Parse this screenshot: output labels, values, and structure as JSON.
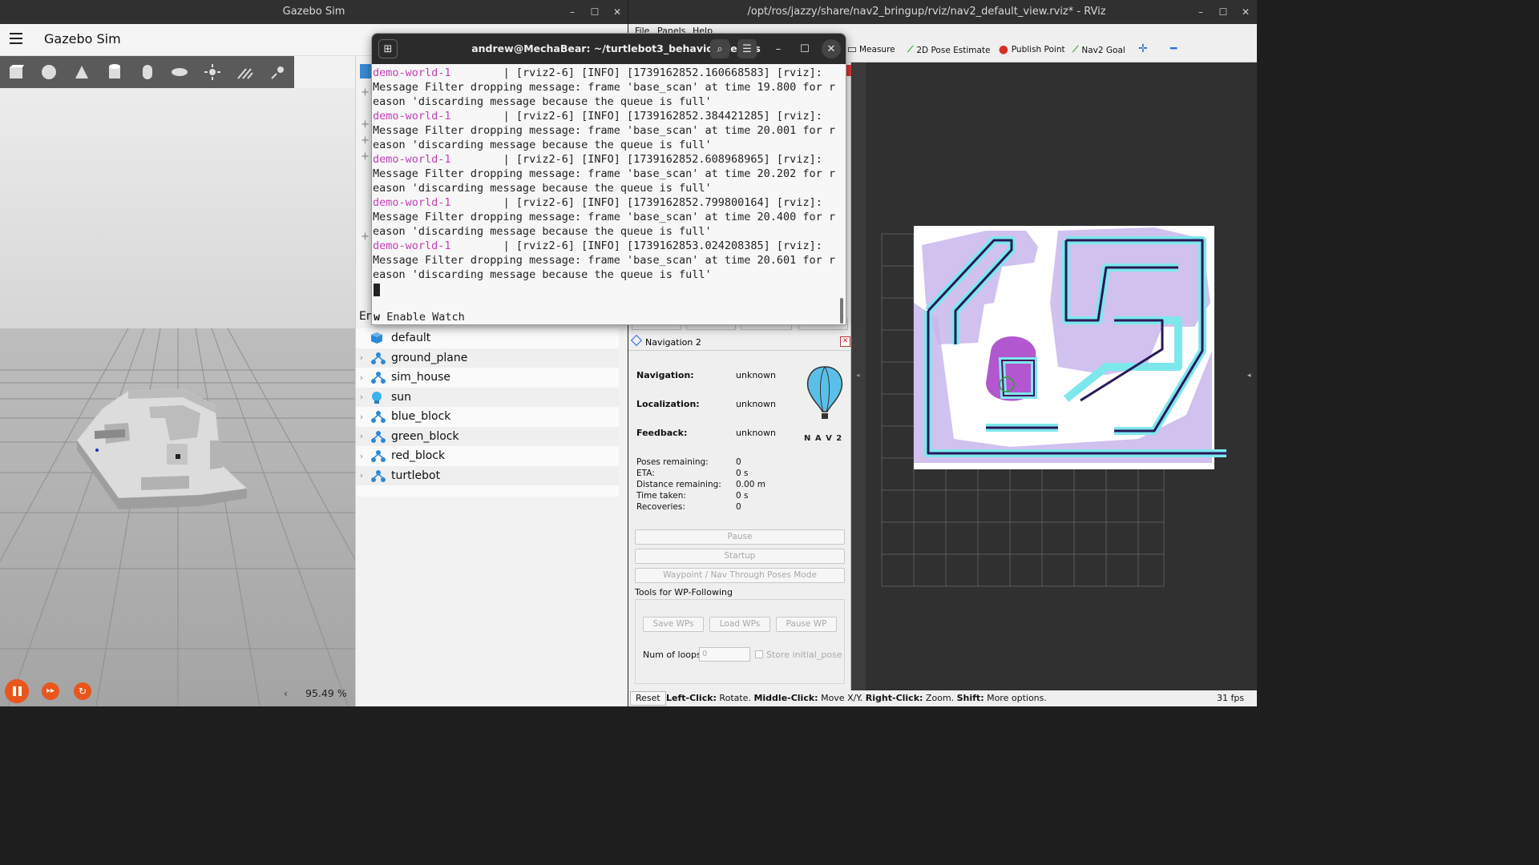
{
  "gazebo": {
    "window_title": "Gazebo Sim",
    "header_title": "Gazebo Sim",
    "rtf": "95.49 %",
    "entities": [
      {
        "name": "default",
        "expandable": false,
        "icon": "model-cube-icon"
      },
      {
        "name": "ground_plane",
        "expandable": true,
        "icon": "model-icon"
      },
      {
        "name": "sim_house",
        "expandable": true,
        "icon": "model-icon"
      },
      {
        "name": "sun",
        "expandable": true,
        "icon": "light-bulb-icon"
      },
      {
        "name": "blue_block",
        "expandable": true,
        "icon": "model-icon"
      },
      {
        "name": "green_block",
        "expandable": true,
        "icon": "model-icon"
      },
      {
        "name": "red_block",
        "expandable": true,
        "icon": "model-icon"
      },
      {
        "name": "turtlebot",
        "expandable": true,
        "icon": "model-icon"
      }
    ],
    "partial_label": "En"
  },
  "terminal": {
    "title": "andrew@MechaBear: ~/turtlebot3_behavior_demos",
    "lines": [
      {
        "prefix": "demo-world-1",
        "text": "        | [rviz2-6] [INFO] [1739162852.160668583] [rviz]:"
      },
      {
        "prefix": "",
        "text": "Message Filter dropping message: frame 'base_scan' at time 19.800 for r"
      },
      {
        "prefix": "",
        "text": "eason 'discarding message because the queue is full'"
      },
      {
        "prefix": "demo-world-1",
        "text": "        | [rviz2-6] [INFO] [1739162852.384421285] [rviz]:"
      },
      {
        "prefix": "",
        "text": "Message Filter dropping message: frame 'base_scan' at time 20.001 for r"
      },
      {
        "prefix": "",
        "text": "eason 'discarding message because the queue is full'"
      },
      {
        "prefix": "demo-world-1",
        "text": "        | [rviz2-6] [INFO] [1739162852.608968965] [rviz]:"
      },
      {
        "prefix": "",
        "text": "Message Filter dropping message: frame 'base_scan' at time 20.202 for r"
      },
      {
        "prefix": "",
        "text": "eason 'discarding message because the queue is full'"
      },
      {
        "prefix": "demo-world-1",
        "text": "        | [rviz2-6] [INFO] [1739162852.799800164] [rviz]:"
      },
      {
        "prefix": "",
        "text": "Message Filter dropping message: frame 'base_scan' at time 20.400 for r"
      },
      {
        "prefix": "",
        "text": "eason 'discarding message because the queue is full'"
      },
      {
        "prefix": "demo-world-1",
        "text": "        | [rviz2-6] [INFO] [1739162853.024208385] [rviz]:"
      },
      {
        "prefix": "",
        "text": "Message Filter dropping message: frame 'base_scan' at time 20.601 for r"
      },
      {
        "prefix": "",
        "text": "eason 'discarding message because the queue is full'"
      }
    ],
    "footer_key": "w",
    "footer_text": " Enable Watch"
  },
  "rviz": {
    "window_title": "/opt/ros/jazzy/share/nav2_bringup/rviz/nav2_default_view.rviz* - RViz",
    "menu": [
      "File",
      "Panels",
      "Help"
    ],
    "tools": [
      "Measure",
      "2D Pose Estimate",
      "Publish Point",
      "Nav2 Goal"
    ],
    "nav_panel": {
      "title": "Navigation 2",
      "navigation_label": "Navigation:",
      "navigation_value": "unknown",
      "localization_label": "Localization:",
      "localization_value": "unknown",
      "feedback_label": "Feedback:",
      "feedback_value": "unknown",
      "logo_text": "N A V 2",
      "stats": [
        {
          "label": "Poses remaining:",
          "value": "0"
        },
        {
          "label": "ETA:",
          "value": "0 s"
        },
        {
          "label": "Distance remaining:",
          "value": "0.00 m"
        },
        {
          "label": "Time taken:",
          "value": "0 s"
        },
        {
          "label": "Recoveries:",
          "value": "0"
        }
      ],
      "pause": "Pause",
      "startup": "Startup",
      "waypoint_mode": "Waypoint / Nav Through Poses Mode",
      "wp_group": "Tools for WP-Following",
      "save_wps": "Save WPs",
      "load_wps": "Load WPs",
      "pause_wp": "Pause WP",
      "num_loops_label": "Num of loops",
      "num_loops_value": "0",
      "store_initial": "Store initial_pose"
    },
    "status": {
      "reset": "Reset",
      "left": "Left-Click:",
      "left_t": " Rotate. ",
      "middle": "Middle-Click:",
      "middle_t": " Move X/Y. ",
      "right": "Right-Click:",
      "right_t": " Zoom. ",
      "shift": "Shift:",
      "shift_t": " More options.",
      "fps": "31 fps"
    }
  }
}
